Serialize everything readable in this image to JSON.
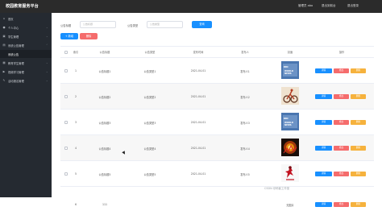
{
  "topbar": {
    "title": "校园教育服务平台",
    "admin_label": "管理员 abo",
    "logout1": "退出到前台",
    "logout2": "退出登录"
  },
  "sidebar": {
    "items": [
      {
        "label": "首页",
        "icon": "home-icon"
      },
      {
        "label": "个人中心",
        "icon": "user-icon"
      },
      {
        "label": "学生管理",
        "icon": "students-icon"
      },
      {
        "label": "系统公告管理",
        "icon": "notice-icon"
      },
      {
        "label": "系统公告",
        "icon": ""
      },
      {
        "label": "教育学生管理",
        "icon": "education-icon"
      },
      {
        "label": "视频学习管理",
        "icon": "video-icon"
      },
      {
        "label": "活动报名管理",
        "icon": "activity-icon"
      }
    ]
  },
  "search": {
    "field1_label": "公告标题",
    "field1_placeholder": "公告标题",
    "field2_label": "公告类型",
    "field2_placeholder": "公告类型",
    "search_button": "查询"
  },
  "toolbar": {
    "add_button": "+ 新增",
    "delete_button": "删除"
  },
  "table": {
    "headers": [
      "索引",
      "公告标题",
      "公告类型",
      "发布时间",
      "发布人",
      "封面",
      "操作"
    ],
    "rows": [
      {
        "index": "1",
        "title": "公告标题1",
        "type": "公告类型1",
        "time": "2021-04-01",
        "publisher": "发布人1",
        "cover": "news"
      },
      {
        "index": "2",
        "title": "公告标题2",
        "type": "公告类型2",
        "time": "2021-04-01",
        "publisher": "发布人2",
        "cover": "bike"
      },
      {
        "index": "3",
        "title": "公告标题3",
        "type": "公告类型3",
        "time": "2021-04-01",
        "publisher": "发布人3",
        "cover": "news"
      },
      {
        "index": "4",
        "title": "公告标题4",
        "type": "公告类型4",
        "time": "2021-04-01",
        "publisher": "发布人4",
        "cover": "fire"
      },
      {
        "index": "5",
        "title": "公告标题5",
        "type": "公告类型5",
        "time": "2021-04-01",
        "publisher": "发布人5",
        "cover": "red"
      }
    ],
    "actions": {
      "detail": "详情",
      "edit": "修改",
      "delete": "删除"
    }
  },
  "news_cover": {
    "line1": "BBC",
    "line2": "WORLD NEWS"
  },
  "partial_row": {
    "index": "6",
    "title": "111",
    "cover": "无图片"
  },
  "watermark": "CSDN @码客工作室"
}
